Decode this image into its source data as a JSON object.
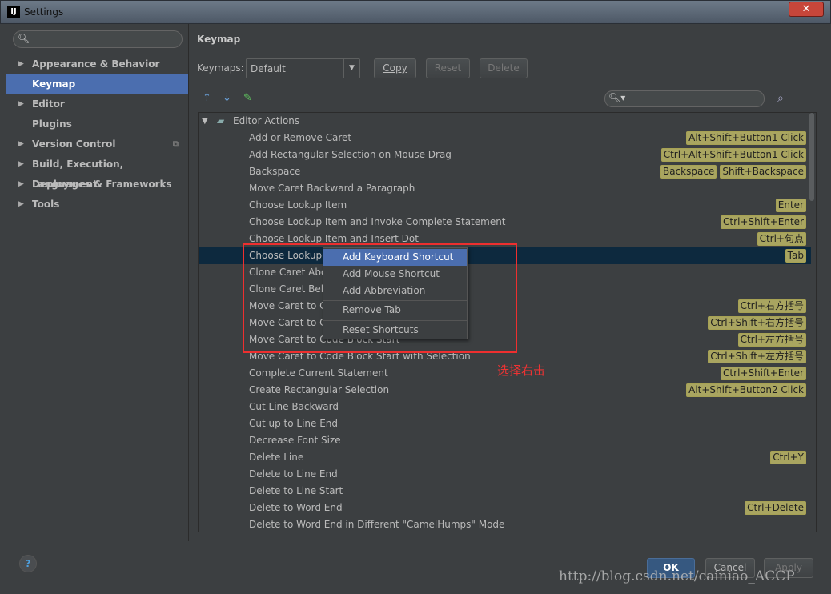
{
  "window": {
    "title": "Settings",
    "close": "✕"
  },
  "search": {
    "placeholder": ""
  },
  "sidebar": {
    "items": [
      {
        "label": "Appearance & Behavior",
        "expandable": true
      },
      {
        "label": "Keymap",
        "selected": true
      },
      {
        "label": "Editor",
        "expandable": true
      },
      {
        "label": "Plugins"
      },
      {
        "label": "Version Control",
        "expandable": true
      },
      {
        "label": "Build, Execution, Deployment",
        "expandable": true
      },
      {
        "label": "Languages & Frameworks",
        "expandable": true
      },
      {
        "label": "Tools",
        "expandable": true
      }
    ]
  },
  "main": {
    "title": "Keymap",
    "keymaps_label": "Keymaps:",
    "keymap_value": "Default",
    "copy": "Copy",
    "reset": "Reset",
    "delete": "Delete"
  },
  "tree": {
    "group": "Editor Actions",
    "rows": [
      {
        "name": "Add or Remove Caret",
        "shortcuts": [
          "Alt+Shift+Button1 Click"
        ]
      },
      {
        "name": "Add Rectangular Selection on Mouse Drag",
        "shortcuts": [
          "Ctrl+Alt+Shift+Button1 Click"
        ]
      },
      {
        "name": "Backspace",
        "shortcuts": [
          "Backspace",
          "Shift+Backspace"
        ]
      },
      {
        "name": "Move Caret Backward a Paragraph",
        "shortcuts": []
      },
      {
        "name": "Choose Lookup Item",
        "shortcuts": [
          "Enter"
        ]
      },
      {
        "name": "Choose Lookup Item and Invoke Complete Statement",
        "shortcuts": [
          "Ctrl+Shift+Enter"
        ]
      },
      {
        "name": "Choose Lookup Item and Insert Dot",
        "shortcuts": [
          "Ctrl+句点"
        ]
      },
      {
        "name": "Choose Lookup",
        "shortcuts": [
          "Tab"
        ],
        "selected": true
      },
      {
        "name": "Clone Caret Abo",
        "shortcuts": []
      },
      {
        "name": "Clone Caret Belo",
        "shortcuts": []
      },
      {
        "name": "Move Caret to C",
        "shortcuts": [
          "Ctrl+右方括号"
        ]
      },
      {
        "name": "Move Caret to C",
        "shortcuts": [
          "Ctrl+Shift+右方括号"
        ]
      },
      {
        "name": "Move Caret to Code Block Start",
        "shortcuts": [
          "Ctrl+左方括号"
        ]
      },
      {
        "name": "Move Caret to Code Block Start with Selection",
        "shortcuts": [
          "Ctrl+Shift+左方括号"
        ]
      },
      {
        "name": "Complete Current Statement",
        "shortcuts": [
          "Ctrl+Shift+Enter"
        ]
      },
      {
        "name": "Create Rectangular Selection",
        "shortcuts": [
          "Alt+Shift+Button2 Click"
        ]
      },
      {
        "name": "Cut Line Backward",
        "shortcuts": []
      },
      {
        "name": "Cut up to Line End",
        "shortcuts": []
      },
      {
        "name": "Decrease Font Size",
        "shortcuts": []
      },
      {
        "name": "Delete Line",
        "shortcuts": [
          "Ctrl+Y"
        ]
      },
      {
        "name": "Delete to Line End",
        "shortcuts": []
      },
      {
        "name": "Delete to Line Start",
        "shortcuts": []
      },
      {
        "name": "Delete to Word End",
        "shortcuts": [
          "Ctrl+Delete"
        ]
      },
      {
        "name": "Delete to Word End in Different \"CamelHumps\" Mode",
        "shortcuts": []
      }
    ]
  },
  "context_menu": {
    "items": [
      "Add Keyboard Shortcut",
      "Add Mouse Shortcut",
      "Add Abbreviation",
      "Remove Tab",
      "Reset Shortcuts"
    ]
  },
  "annotation": "选择右击",
  "footer": {
    "help": "?",
    "ok": "OK",
    "cancel": "Cancel",
    "apply": "Apply"
  },
  "watermark": "http://blog.csdn.net/cainiao_ACCP",
  "colors": {
    "selection": "#4b6eaf",
    "selected_row": "#0d293e",
    "annotation": "#ee2f2f",
    "shortcut_badge": "#a9a560"
  }
}
